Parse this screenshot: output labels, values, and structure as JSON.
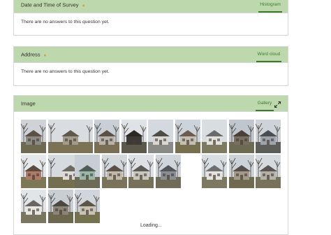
{
  "questions": [
    {
      "title": "Date and Time of Survey",
      "view_tab": "Histogram",
      "message": "There are no answers to this question yet."
    },
    {
      "title": "Address",
      "view_tab": "Word cloud",
      "message": "There are no answers to this question yet."
    },
    {
      "title": "Image",
      "view_tab": "Gallery"
    }
  ],
  "status": {
    "loading": "Loading..."
  },
  "colors": {
    "header_bg": "#bdd8ad",
    "accent": "#3b7a2a",
    "required_dot": "#d9a43b"
  },
  "icons": {
    "expand": "expand-icon"
  },
  "gallery": {
    "photo_count": 21,
    "photos": [
      {
        "sky": "#cfd3d8",
        "ground": "#6e6a52",
        "house": "#8d8a82",
        "roof": "#5a5046",
        "trees": true
      },
      {
        "sky": "#d9dde1",
        "ground": "#7c7357",
        "house": "#a29a8b",
        "roof": "#60574d",
        "trees": true
      },
      {
        "sky": "#c9cfd6",
        "ground": "#7a6f55",
        "house": "#b8b2a8",
        "roof": "#59514a",
        "trees": true
      },
      {
        "sky": "#dfe2e6",
        "ground": "#5c594c",
        "house": "#3d3a36",
        "roof": "#2c2925",
        "trees": true
      },
      {
        "sky": "#d4d9df",
        "ground": "#8a8a86",
        "house": "#d8d6d1",
        "roof": "#4e4a45",
        "trees": false
      },
      {
        "sky": "#cdd3da",
        "ground": "#77704f",
        "house": "#c4bdb0",
        "roof": "#6a5d50",
        "trees": true
      },
      {
        "sky": "#d8dde2",
        "ground": "#7e7a60",
        "house": "#e2e0db",
        "roof": "#6a6a6a",
        "trees": false
      },
      {
        "sky": "#bfc6ce",
        "ground": "#6c6a52",
        "house": "#7a6e60",
        "roof": "#4a4038",
        "trees": true
      },
      {
        "sky": "#cdd3d9",
        "ground": "#5d5d59",
        "house": "#9ea4ab",
        "roof": "#4a4e53",
        "trees": true
      },
      {
        "sky": "#e5e8eb",
        "ground": "#7b7757",
        "house": "#b07a66",
        "roof": "#5a4a40",
        "trees": true
      },
      {
        "sky": "#d6dbe0",
        "ground": "#756f52",
        "house": "#dedbd5",
        "roof": "#6e6a63",
        "trees": true
      },
      {
        "sky": "#c7ced5",
        "ground": "#6d6b55",
        "house": "#9bb7a9",
        "roof": "#4f5c55",
        "trees": false
      },
      {
        "sky": "#d3d8dd",
        "ground": "#79735a",
        "house": "#c2b9ab",
        "roof": "#5b5149",
        "trees": true
      },
      {
        "sky": "#dde1e5",
        "ground": "#76715a",
        "house": "#cac6be",
        "roof": "#5e5a55",
        "trees": true
      },
      {
        "sky": "#cfd5db",
        "ground": "#6e6b58",
        "house": "#8a8e92",
        "roof": "#53565a",
        "trees": true
      },
      {
        "sky": "#d9dee3",
        "ground": "#7d7860",
        "house": "#e4e3e0",
        "roof": "#707070",
        "trees": true
      },
      {
        "sky": "#ccd2d8",
        "ground": "#6f6a50",
        "house": "#a39a8a",
        "roof": "#57504a",
        "trees": true
      },
      {
        "sky": "#d5dade",
        "ground": "#77725a",
        "house": "#b5b0a8",
        "roof": "#5a5550",
        "trees": true
      },
      {
        "sky": "#e2e5e8",
        "ground": "#7a7560",
        "house": "#e8e6e2",
        "roof": "#6a6560",
        "trees": true
      },
      {
        "sky": "#c8ced4",
        "ground": "#6c6850",
        "house": "#8c8478",
        "roof": "#4e4740",
        "trees": true
      },
      {
        "sky": "#d1d6dc",
        "ground": "#76714f",
        "house": "#c9c3b5",
        "roof": "#5d544a",
        "trees": true
      },
      {
        "sky": "#dadfe3",
        "ground": "#7c775c",
        "house": "#b9b1a3",
        "roof": "#5f564d",
        "trees": true
      }
    ]
  }
}
